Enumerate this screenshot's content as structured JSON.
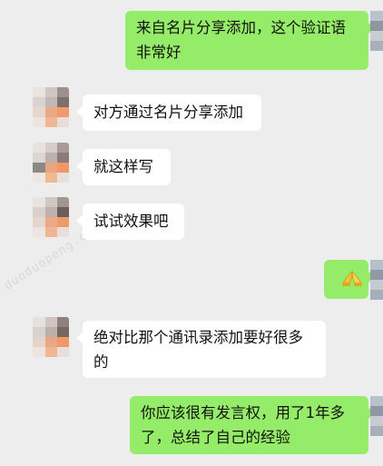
{
  "chat": {
    "messages": [
      {
        "side": "out",
        "text_lines": [
          "来自名片分享添加，这个验证语",
          "非常好"
        ]
      },
      {
        "side": "in",
        "text_lines": [
          "对方通过名片分享添加"
        ]
      },
      {
        "side": "in",
        "text_lines": [
          "就这样写"
        ]
      },
      {
        "side": "in",
        "text_lines": [
          "试试效果吧"
        ]
      },
      {
        "side": "out",
        "emoji": "folded-hands"
      },
      {
        "side": "in",
        "text_lines": [
          "绝对比那个通讯录添加要好很多",
          "的"
        ]
      },
      {
        "side": "out",
        "text_lines": [
          "你应该很有发言权，用了1年多",
          "了，总结了自己的经验"
        ]
      }
    ]
  },
  "watermark": {
    "text": "duoduopeng.cn"
  },
  "colors": {
    "background": "#ededed",
    "incoming_bubble": "#ffffff",
    "outgoing_bubble": "#95ec69"
  }
}
